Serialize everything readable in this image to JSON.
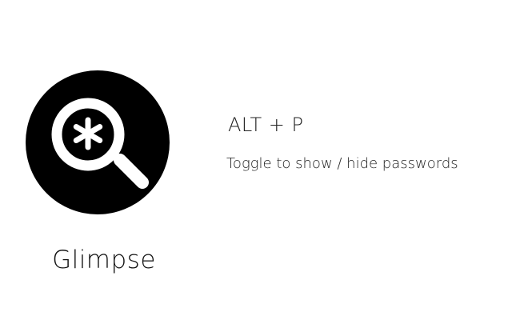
{
  "app": {
    "name": "Glimpse",
    "logo_icon": "magnifier-asterisk-icon"
  },
  "shortcut": {
    "keys": "ALT + P",
    "description": "Toggle to show / hide passwords"
  },
  "colors": {
    "background": "#ffffff",
    "logo": "#000000",
    "logo_glyph": "#ffffff",
    "text": "#111111"
  }
}
